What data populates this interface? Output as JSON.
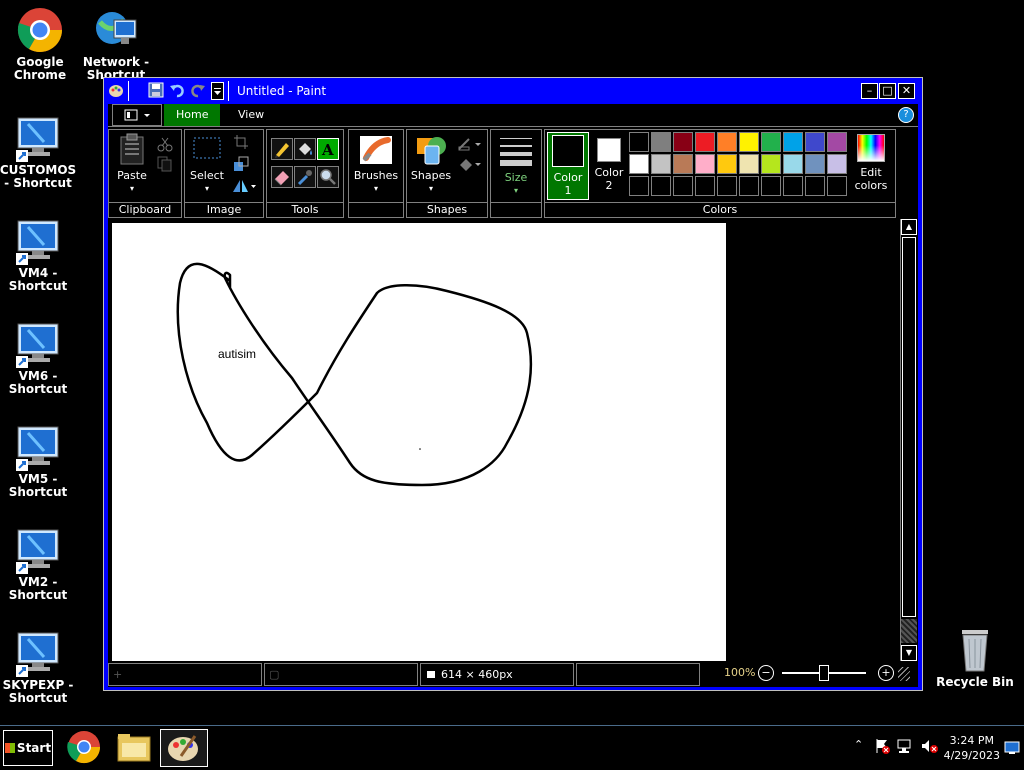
{
  "desktop": {
    "icons": [
      {
        "label": "Google Chrome",
        "icon": "chrome-icon"
      },
      {
        "label": "Network - Shortcut",
        "icon": "network-icon"
      },
      {
        "label": "CUSTOMOS - Shortcut",
        "icon": "computer-icon"
      },
      {
        "label": "VM4 - Shortcut",
        "icon": "computer-icon"
      },
      {
        "label": "VM6 - Shortcut",
        "icon": "computer-icon"
      },
      {
        "label": "VM5 - Shortcut",
        "icon": "computer-icon"
      },
      {
        "label": "VM2 - Shortcut",
        "icon": "computer-icon"
      },
      {
        "label": "SKYPEXP - Shortcut",
        "icon": "computer-icon"
      },
      {
        "label": "Recycle Bin",
        "icon": "recycle-bin-icon"
      }
    ]
  },
  "window": {
    "title": "Untitled - Paint",
    "tabs": [
      {
        "label": "Home"
      },
      {
        "label": "View"
      }
    ],
    "ribbon": {
      "clipboard": {
        "label": "Clipboard",
        "paste": "Paste"
      },
      "image": {
        "label": "Image",
        "select": "Select"
      },
      "tools": {
        "label": "Tools"
      },
      "brushes": {
        "label": "Brushes"
      },
      "shapes": {
        "label": "Shapes",
        "button": "Shapes"
      },
      "size": {
        "label": "Size"
      },
      "colors": {
        "label": "Colors",
        "color1": "Color 1",
        "color2": "Color 2",
        "edit": "Edit colors",
        "palette_row1": [
          "#000000",
          "#7f7f7f",
          "#880015",
          "#ed1c24",
          "#ff7f27",
          "#fff200",
          "#22b14c",
          "#00a2e8",
          "#3f48cc",
          "#a349a4"
        ],
        "palette_row2": [
          "#ffffff",
          "#c3c3c3",
          "#b97a57",
          "#ffaec9",
          "#ffc90e",
          "#efe4b0",
          "#b5e61d",
          "#99d9ea",
          "#7092be",
          "#c8bfe7"
        ]
      }
    },
    "canvas": {
      "text": "autisim"
    },
    "status": {
      "size": "614 × 460px",
      "zoom": "100%"
    }
  },
  "taskbar": {
    "start": "Start",
    "time": "3:24 PM",
    "date": "4/29/2023"
  }
}
